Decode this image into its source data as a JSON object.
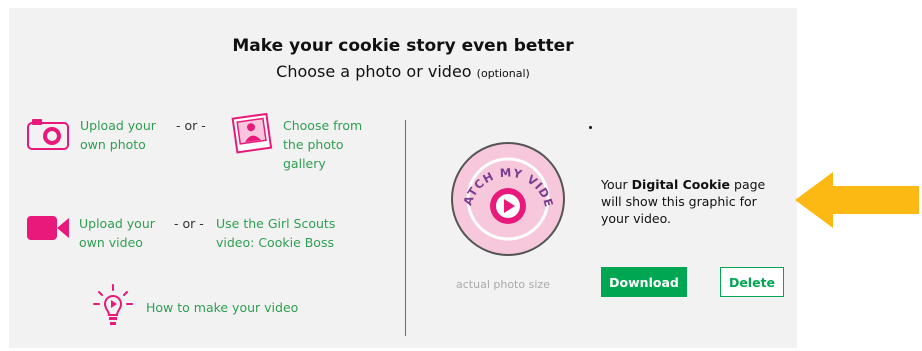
{
  "header": {
    "title": "Make your cookie story even better",
    "subtitle": "Choose a photo or video",
    "optional": "(optional)"
  },
  "options": {
    "upload_photo": [
      "Upload your",
      "own photo"
    ],
    "or1": "- or -",
    "choose_gallery": [
      "Choose from",
      "the photo",
      "gallery"
    ],
    "upload_video": [
      "Upload your",
      "own video"
    ],
    "or2": "- or -",
    "girl_scouts_video": [
      "Use the Girl Scouts",
      "video: Cookie Boss"
    ],
    "how_to": "How to make your video"
  },
  "preview": {
    "badge_text": "WATCH MY VIDEO",
    "photo_size": "actual photo size",
    "info_prefix": "Your ",
    "info_bold": "Digital Cookie",
    "info_rest": " page will show this graphic for your video."
  },
  "buttons": {
    "download": "Download",
    "delete": "Delete"
  },
  "colors": {
    "accent_pink": "#e8197a",
    "green": "#00a651",
    "panel_bg": "#f2f2f2",
    "arrow": "#fdb913"
  }
}
